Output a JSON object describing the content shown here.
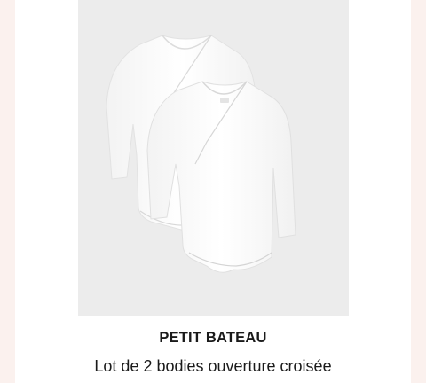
{
  "product": {
    "brand": "PETIT BATEAU",
    "title": "Lot de 2 bodies ouverture croisée",
    "image_icon": "bodysuit-pair-image"
  },
  "colors": {
    "page_background": "#fcf6f4",
    "card_background": "#ffffff",
    "image_background": "#ececec",
    "text": "#1a1a1a"
  }
}
